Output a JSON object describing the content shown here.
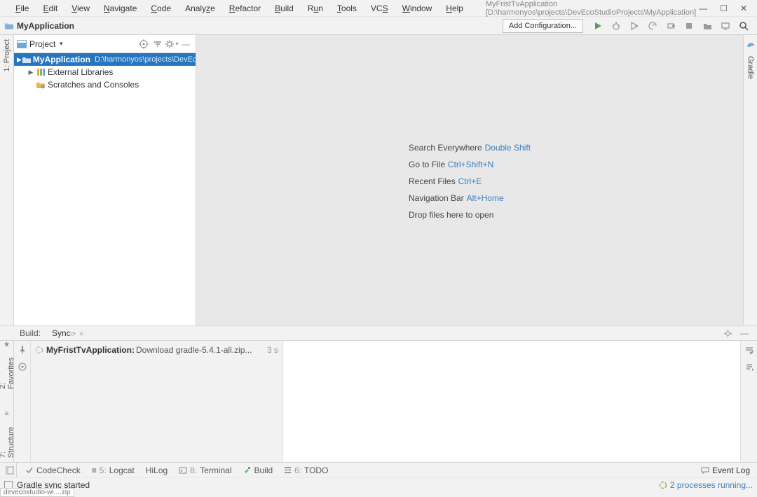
{
  "window": {
    "title": "MyFristTvApplication [D:\\harmonyos\\projects\\DevEcoStudioProjects\\MyApplication]"
  },
  "menu": {
    "items": [
      "File",
      "Edit",
      "View",
      "Navigate",
      "Code",
      "Analyze",
      "Refactor",
      "Build",
      "Run",
      "Tools",
      "VCS",
      "Window",
      "Help"
    ]
  },
  "breadcrumb": {
    "name": "MyApplication"
  },
  "toolbar": {
    "add_config": "Add Configuration..."
  },
  "project_panel": {
    "title": "Project",
    "nodes": {
      "root": {
        "label": "MyApplication",
        "path": "D:\\harmonyos\\projects\\DevEcoStudioProjects\\MyApplication"
      },
      "ext": {
        "label": "External Libraries"
      },
      "scr": {
        "label": "Scratches and Consoles"
      }
    }
  },
  "left_gutter": {
    "project_label": "1: Project"
  },
  "right_gutter": {
    "gradle_label": "Gradle"
  },
  "editor_hints": {
    "search": {
      "text": "Search Everywhere",
      "shortcut": "Double Shift"
    },
    "goto": {
      "text": "Go to File",
      "shortcut": "Ctrl+Shift+N"
    },
    "recent": {
      "text": "Recent Files",
      "shortcut": "Ctrl+E"
    },
    "nav": {
      "text": "Navigation Bar",
      "shortcut": "Alt+Home"
    },
    "drop": {
      "text": "Drop files here to open"
    }
  },
  "build": {
    "label": "Build:",
    "tab": "Sync",
    "task_name": "MyFristTvApplication:",
    "task_desc": "Download gradle-5.4.1-all.zip...",
    "task_time": "3 s"
  },
  "left_side_tabs": {
    "favorites": "2: Favorites",
    "structure": "7: Structure"
  },
  "bottom_tools": {
    "codecheck": "CodeCheck",
    "logcat": "Logcat",
    "hilog": "HiLog",
    "terminal": "Terminal",
    "build": "Build",
    "todo": "TODO",
    "logcat_num": "5:",
    "terminal_num": "8:",
    "todo_num": "6:",
    "eventlog": "Event Log"
  },
  "status": {
    "msg": "Gradle sync started",
    "proc": "2 processes running..."
  },
  "truncated_hint": "devecostudio-wi....zip"
}
